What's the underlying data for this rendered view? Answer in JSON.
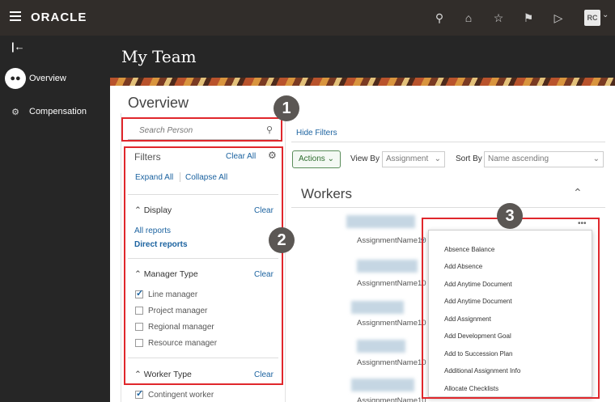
{
  "topbar": {
    "logo": "ORACLE",
    "icons": [
      "search-icon",
      "home-icon",
      "star-icon",
      "flag-icon",
      "play-icon"
    ],
    "avatar": "RC"
  },
  "sidebar": {
    "items": [
      {
        "label": "Overview"
      },
      {
        "label": "Compensation"
      }
    ]
  },
  "header": {
    "title": "My Team"
  },
  "main": {
    "heading": "Overview",
    "search_placeholder": "Search Person",
    "hide_filters": "Hide Filters"
  },
  "filters": {
    "label": "Filters",
    "clear_all": "Clear All",
    "expand_all": "Expand All",
    "collapse_all": "Collapse All",
    "display": {
      "title": "Display",
      "clear": "Clear",
      "options": [
        "All reports",
        "Direct reports"
      ]
    },
    "manager_type": {
      "title": "Manager Type",
      "clear": "Clear",
      "options": [
        {
          "label": "Line manager",
          "checked": true
        },
        {
          "label": "Project manager",
          "checked": false
        },
        {
          "label": "Regional manager",
          "checked": false
        },
        {
          "label": "Resource manager",
          "checked": false
        }
      ]
    },
    "worker_type": {
      "title": "Worker Type",
      "clear": "Clear",
      "options": [
        {
          "label": "Contingent worker",
          "checked": true
        }
      ]
    }
  },
  "toolbar": {
    "actions": "Actions",
    "view_by_label": "View By",
    "view_by_value": "Assignment",
    "sort_by_label": "Sort By",
    "sort_by_value": "Name ascending"
  },
  "workers": {
    "heading": "Workers",
    "rows": [
      "AssignmentName10",
      "AssignmentName10",
      "AssignmentName10",
      "AssignmentName10",
      "AssignmentName10"
    ],
    "more": "•••"
  },
  "menu": {
    "items": [
      "Absence Balance",
      "Add Absence",
      "Add Anytime Document",
      "Add Anytime Document",
      "Add Assignment",
      "Add Development Goal",
      "Add to Succession Plan",
      "Additional Assignment Info",
      "Allocate Checklists"
    ]
  },
  "callouts": [
    "1",
    "2",
    "3"
  ],
  "colors": {
    "callout_border": "#e0272c",
    "link": "#1c63a0",
    "topbar": "#312d2a"
  }
}
